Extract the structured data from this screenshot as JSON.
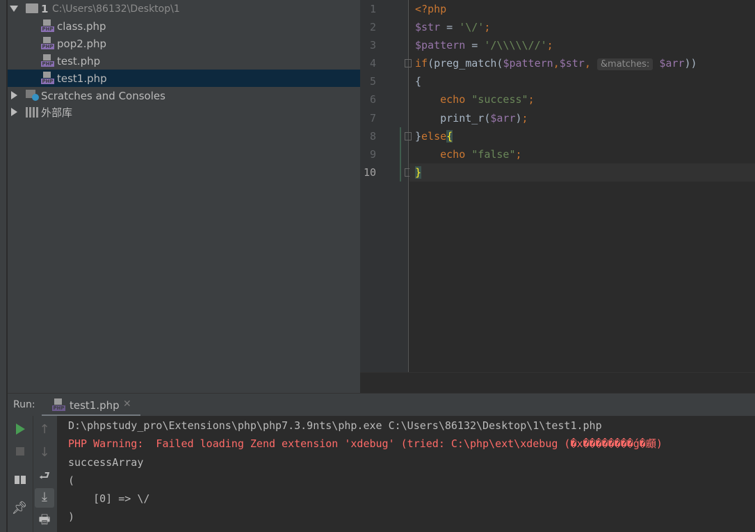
{
  "project": {
    "root": {
      "name": "1",
      "path": "C:\\Users\\86132\\Desktop\\1"
    },
    "files": [
      {
        "name": "class.php"
      },
      {
        "name": "pop2.php"
      },
      {
        "name": "test.php"
      },
      {
        "name": "test1.php",
        "selected": true
      }
    ],
    "scratches": "Scratches and Consoles",
    "external": "外部库"
  },
  "editor": {
    "line_numbers": [
      "1",
      "2",
      "3",
      "4",
      "5",
      "6",
      "7",
      "8",
      "9",
      "10"
    ],
    "current_line": "10",
    "param_hint": "&matches:",
    "code": {
      "l1": "<?php",
      "l2_var": "$str",
      "l2_op": " = ",
      "l2_str": "'\\/'",
      "l2_end": ";",
      "l3_var": "$pattern",
      "l3_op": " = ",
      "l3_str": "'/\\\\\\\\\\//'",
      "l3_end": ";",
      "l4_kw": "if",
      "l4_a": "(preg_match(",
      "l4_v1": "$pattern",
      "l4_c": ",",
      "l4_v2": "$str",
      "l4_c2": ", ",
      "l4_v3": "$arr",
      "l4_e": "))",
      "l5": "{",
      "l6_kw": "    echo ",
      "l6_str": "\"success\"",
      "l6_end": ";",
      "l7_a": "    print_r(",
      "l7_v": "$arr",
      "l7_b": ")",
      "l7_end": ";",
      "l8_a": "}",
      "l8_kw": "else",
      "l8_b": "{",
      "l9_kw": "    echo ",
      "l9_str": "\"false\"",
      "l9_end": ";",
      "l10": "}"
    }
  },
  "run": {
    "label": "Run:",
    "tab": "test1.php",
    "output": [
      {
        "text": "D:\\phpstudy_pro\\Extensions\\php\\php7.3.9nts\\php.exe C:\\Users\\86132\\Desktop\\1\\test1.php",
        "type": "normal"
      },
      {
        "text": "PHP Warning:  Failed loading Zend extension 'xdebug' (tried: C:\\php\\ext\\xdebug (�x��������ǵ�顣)",
        "type": "error"
      },
      {
        "text": "successArray",
        "type": "normal"
      },
      {
        "text": "(",
        "type": "normal"
      },
      {
        "text": "    [0] => \\/",
        "type": "normal"
      },
      {
        "text": ")",
        "type": "normal"
      }
    ]
  },
  "colors": {
    "keyword": "#cc7832",
    "variable": "#9876aa",
    "string": "#6a8759",
    "error": "#ff6b68",
    "selection": "#0d293e",
    "run_green": "#499c54"
  }
}
